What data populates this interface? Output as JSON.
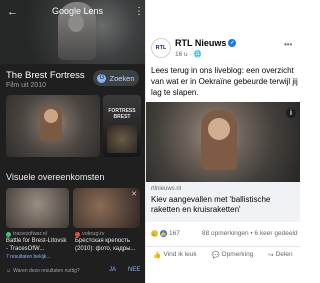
{
  "lens": {
    "back_icon": "arrow-left",
    "header_label": "Google Lens",
    "title": "The Brest Fortress",
    "subtitle": "Film uit 2010",
    "search_button": "Zoeken",
    "side_poster_text": "FORTRESS BREST",
    "visual_matches_title": "Visuele overeenkomsten",
    "visual_matches": [
      {
        "source": "tracesofwar.nl",
        "caption": "Battle for Brest-Litovsk - TracesOfW...",
        "subcaption": "7 resultaten bekijk...",
        "source_color": "#3ec16d"
      },
      {
        "source": "vokrug.tv",
        "caption": "Брестская крепость (2010): фото, кадры...",
        "subcaption": "",
        "source_color": "#e84c3d"
      }
    ],
    "feedback_question": "Waren deze resultaten nuttig?",
    "feedback_yes": "JA",
    "feedback_no": "NEE"
  },
  "post": {
    "page_name": "RTL Nieuws",
    "avatar_text": "RTL",
    "time": "16 u · ",
    "text": "Lees terug in ons liveblog: een overzicht van wat er in Oekraïne gebeurde terwijl jij lag te slapen.",
    "link_domain": "rtlnieuws.nl",
    "link_headline": "Kiev aangevallen met 'ballistische raketten en kruisraketten'",
    "reaction_count": "167",
    "comments_shares": "88 opmerkingen • 6 keer gedeeld",
    "actions": {
      "like": "Vind ik leuk",
      "comment": "Opmerking",
      "share": "Delen"
    }
  },
  "colors": {
    "accent": "#1877f2",
    "lens_bg": "#1f1f1f",
    "lens_link": "#8ab4f8"
  }
}
